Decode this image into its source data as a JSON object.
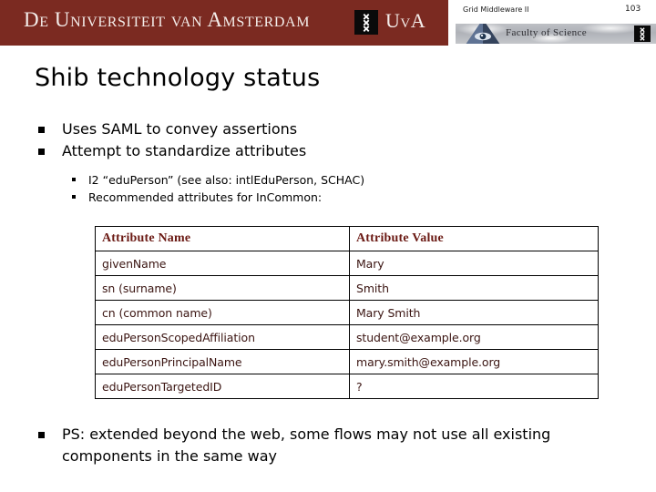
{
  "header": {
    "university_wordmark": "De Universiteit van Amsterdam",
    "university_abbrev": "UvA",
    "course_title": "Grid Middleware II",
    "slide_number": "103",
    "faculty_label": "Faculty of Science",
    "banner_color": "#7B2A21",
    "arms_box_color": "#0A0A0A"
  },
  "slide": {
    "title": "Shib technology status",
    "bullets_level1": [
      "Uses SAML to convey assertions",
      "Attempt to standardize attributes"
    ],
    "bullets_level2": [
      "I2 “eduPerson” (see also: intlEduPerson, SCHAC)",
      "Recommended attributes for InCommon:"
    ],
    "footer_bullet": "PS: extended beyond the web, some flows may not use all existing components in the same way"
  },
  "table": {
    "headers": [
      "Attribute Name",
      "Attribute Value"
    ],
    "header_color": "#6B1A14",
    "cell_color": "#3B1512",
    "rows": [
      [
        "givenName",
        "Mary"
      ],
      [
        "sn (surname)",
        "Smith"
      ],
      [
        "cn (common name)",
        "Mary Smith"
      ],
      [
        "eduPersonScopedAffiliation",
        "student@example.org"
      ],
      [
        "eduPersonPrincipalName",
        "mary.smith@example.org"
      ],
      [
        "eduPersonTargetedID",
        "?"
      ]
    ]
  }
}
